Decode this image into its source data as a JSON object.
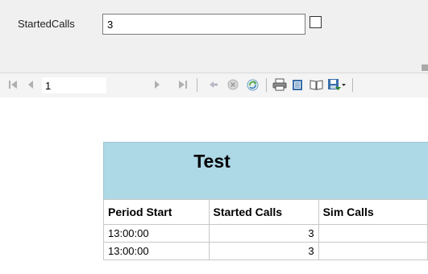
{
  "parameters": {
    "label": "StartedCalls",
    "value": "3",
    "null_checked": false
  },
  "toolbar": {
    "page_number": "1",
    "icons": [
      "first-page-icon",
      "prev-page-icon",
      "next-page-icon",
      "last-page-icon",
      "back-icon",
      "stop-icon",
      "refresh-icon",
      "print-icon",
      "print-layout-icon",
      "page-setup-icon",
      "export-icon"
    ]
  },
  "report": {
    "title": "Test",
    "columns": [
      "Period Start",
      "Started Calls",
      "Sim Calls"
    ],
    "rows": [
      {
        "period_start": "13:00:00",
        "started_calls": "3",
        "sim_calls": ""
      },
      {
        "period_start": "13:00:00",
        "started_calls": "3",
        "sim_calls": ""
      }
    ],
    "title_bg": "#add8e6"
  }
}
